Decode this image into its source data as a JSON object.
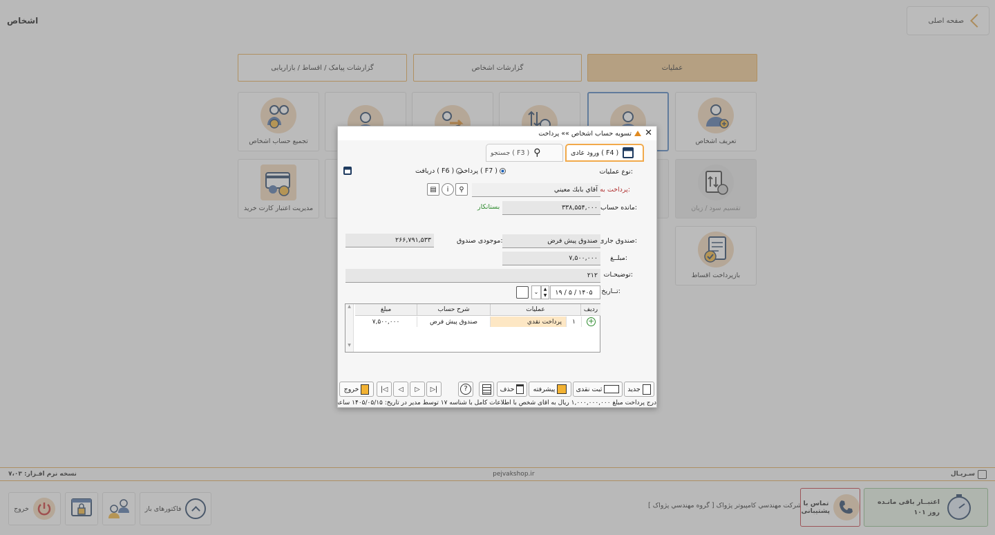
{
  "app": {
    "title": "اشخاص",
    "home_label": "صفحه اصلی"
  },
  "tabs": [
    {
      "label": "گزارشات پیامک / اقساط / بازاریابی"
    },
    {
      "label": "گزارشات اشخاص"
    },
    {
      "label": "عملیات"
    }
  ],
  "tiles": [
    {
      "label": "تجمیع حساب اشخاص"
    },
    {
      "label": "تعریف اشخاص"
    },
    {
      "label": "مدیریت اعتبار کارت خرید"
    },
    {
      "label": "تقسیم سود / زیان"
    },
    {
      "label": "بازپرداخت اقساط"
    }
  ],
  "dialog": {
    "title": "تسویه حساب اشخاص »» پرداخت",
    "tab_normal": "ورود عادی ( F4 )",
    "tab_search": "جستجو ( F3 )",
    "op_type_label": "نوع عملیات:",
    "receive_label": "دریافت ( F6 )",
    "pay_label": "پرداخت ( F7 )",
    "pay_to_label": "پرداخت به:",
    "pay_to_value": "آقاي بابك معيني",
    "balance_label": "مانده حساب:",
    "balance_value": "۳۳۸,۵۵۴,۰۰۰",
    "balance_status": "بستانکار",
    "cash_label": "صندوق جاری:",
    "cash_value": "صندوق پیش فرض",
    "cash_stock_label": "موجودی صندوق:",
    "cash_stock_value": "۲۶۶,۷۹۱,۵۳۳",
    "amount_label": "مبلــغ:",
    "amount_value": "۷,۵۰۰,۰۰۰",
    "desc_label": "توضیحـات:",
    "desc_value": "۲۱۲",
    "date_label": "تــاریخ:",
    "date_value": "۱۹ / ۵ / ۱۴۰۵",
    "grid": {
      "headers": [
        "ردیف",
        "عملیات",
        "شرح حساب",
        "مبلغ"
      ],
      "rows": [
        {
          "row": "۱",
          "op": "پرداخت نقدي",
          "desc": "صندوق پیش فرض",
          "amount": "۷,۵۰۰,۰۰۰"
        }
      ]
    },
    "buttons": {
      "new": "جدید",
      "cash_register": "ثبت نقدی",
      "advanced": "پیشرفته",
      "delete": "حذف",
      "exit": "خروج"
    },
    "message": "درج پرداخت مبلغ ۱,۰۰۰,۰۰۰,۰۰۰ ریال به آقای شخص با اطلاعات کامل با شناسه ۱۷ توسط مدیر در تاریخ: ۱۴۰۵/۰۵/۱۵ ساعت"
  },
  "status": {
    "version": "نسخه نرم افـزار: ۷،۰۳",
    "site": "pejvakshop.ir",
    "serial": "سـريـال"
  },
  "bottom": {
    "exit": "خروج",
    "open_invoices": "فاکتورهای باز",
    "company": "شرکت مهندسي کامپیوتر پژواک [ گروه مهندسي پژواک ]",
    "support": "تماس با پشتیبانی",
    "credit_title": "اعتبــار باقی مانـده",
    "credit_days": "۱۰۱ روز"
  },
  "colors": {
    "accent": "#e8a94a",
    "active_tab": "#f3c98c",
    "link_red": "#b03030",
    "creditor_green": "#2e8b2e"
  }
}
